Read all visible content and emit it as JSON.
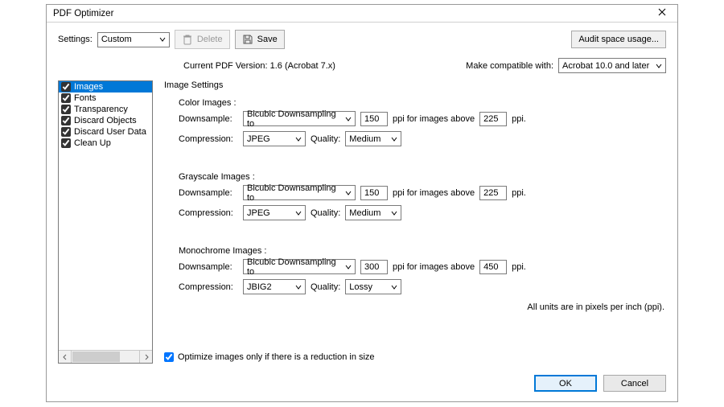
{
  "window": {
    "title": "PDF Optimizer"
  },
  "toolbar": {
    "settings_label": "Settings:",
    "settings_value": "Custom",
    "delete_label": "Delete",
    "save_label": "Save",
    "audit_label": "Audit space usage..."
  },
  "version": {
    "current_label": "Current PDF Version: 1.6 (Acrobat 7.x)",
    "compat_label": "Make compatible with:",
    "compat_value": "Acrobat 10.0 and later"
  },
  "categories": [
    {
      "label": "Images",
      "checked": true,
      "selected": true
    },
    {
      "label": "Fonts",
      "checked": true,
      "selected": false
    },
    {
      "label": "Transparency",
      "checked": true,
      "selected": false
    },
    {
      "label": "Discard Objects",
      "checked": true,
      "selected": false
    },
    {
      "label": "Discard User Data",
      "checked": true,
      "selected": false
    },
    {
      "label": "Clean Up",
      "checked": true,
      "selected": false
    }
  ],
  "settings": {
    "title": "Image Settings",
    "group1": {
      "heading": "Color Images :",
      "downsample_label": "Downsample:",
      "downsample_method": "Bicubic Downsampling to",
      "downsample_ppi": "150",
      "ppi_mid": "ppi for images above",
      "above_ppi": "225",
      "ppi_suffix": "ppi.",
      "compression_label": "Compression:",
      "compression_method": "JPEG",
      "quality_label": "Quality:",
      "quality_value": "Medium"
    },
    "group2": {
      "heading": "Grayscale Images :",
      "downsample_label": "Downsample:",
      "downsample_method": "Bicubic Downsampling to",
      "downsample_ppi": "150",
      "ppi_mid": "ppi for images above",
      "above_ppi": "225",
      "ppi_suffix": "ppi.",
      "compression_label": "Compression:",
      "compression_method": "JPEG",
      "quality_label": "Quality:",
      "quality_value": "Medium"
    },
    "group3": {
      "heading": "Monochrome Images :",
      "downsample_label": "Downsample:",
      "downsample_method": "Bicubic Downsampling to",
      "downsample_ppi": "300",
      "ppi_mid": "ppi for images above",
      "above_ppi": "450",
      "ppi_suffix": "ppi.",
      "compression_label": "Compression:",
      "compression_method": "JBIG2",
      "quality_label": "Quality:",
      "quality_value": "Lossy"
    },
    "units_note": "All units are in pixels per inch (ppi)."
  },
  "optimize_checkbox": {
    "label": "Optimize images only if there is a reduction in size",
    "checked": true
  },
  "footer": {
    "ok": "OK",
    "cancel": "Cancel"
  }
}
